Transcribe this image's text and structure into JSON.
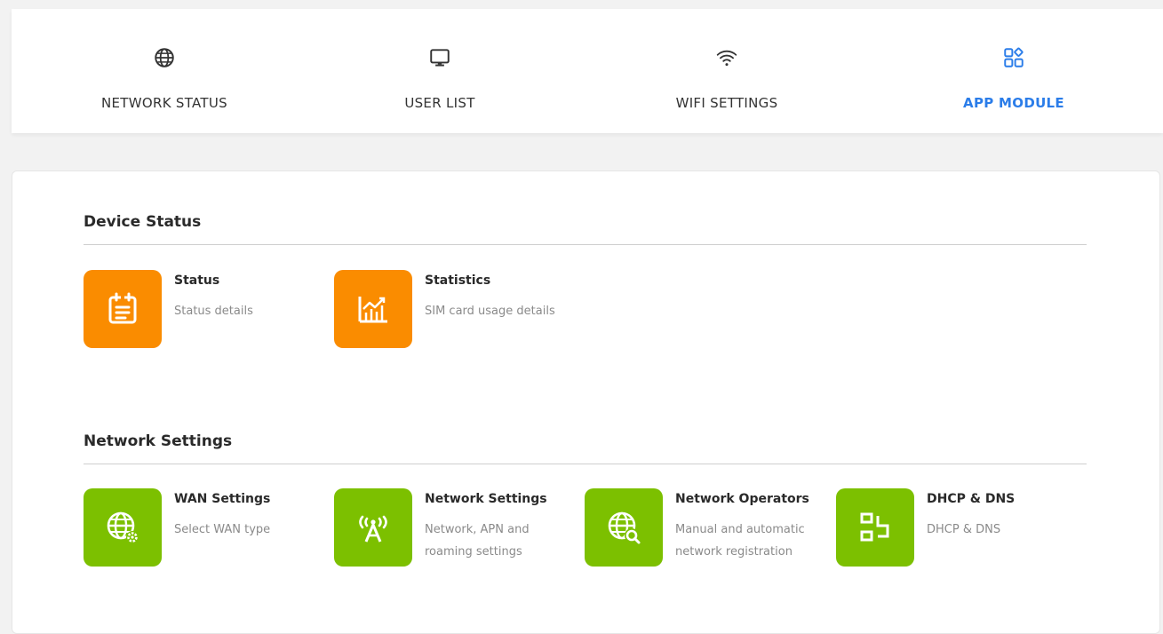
{
  "nav": {
    "items": [
      {
        "label": "NETWORK STATUS",
        "icon": "globe-icon",
        "active": false
      },
      {
        "label": "USER LIST",
        "icon": "monitor-icon",
        "active": false
      },
      {
        "label": "WIFI SETTINGS",
        "icon": "wifi-icon",
        "active": false
      },
      {
        "label": "APP MODULE",
        "icon": "app-grid-icon",
        "active": true
      }
    ],
    "active_color": "#2b7de9"
  },
  "sections": [
    {
      "title": "Device Status",
      "tiles": [
        {
          "title": "Status",
          "desc": "Status details",
          "icon": "calendar-list-icon",
          "color": "#fa8c00"
        },
        {
          "title": "Statistics",
          "desc": "SIM card usage details",
          "icon": "chart-icon",
          "color": "#fa8c00"
        }
      ]
    },
    {
      "title": "Network Settings",
      "tiles": [
        {
          "title": "WAN Settings",
          "desc": "Select WAN type",
          "icon": "globe-gear-icon",
          "color": "#7cc000"
        },
        {
          "title": "Network Settings",
          "desc": "Network, APN and roaming settings",
          "icon": "antenna-icon",
          "color": "#7cc000"
        },
        {
          "title": "Network Operators",
          "desc": "Manual and automatic network registration",
          "icon": "globe-search-icon",
          "color": "#7cc000"
        },
        {
          "title": "DHCP & DNS",
          "desc": "DHCP & DNS",
          "icon": "dhcp-icon",
          "color": "#7cc000"
        }
      ]
    }
  ]
}
